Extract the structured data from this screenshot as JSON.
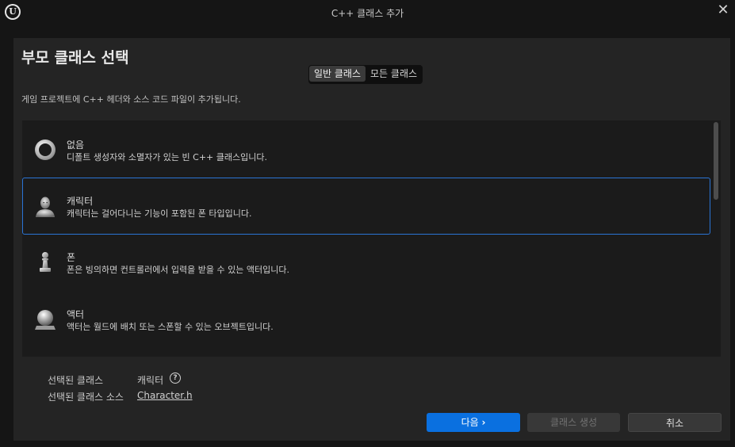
{
  "window": {
    "title": "C++ 클래스 추가",
    "close_icon": "✕"
  },
  "heading": "부모 클래스 선택",
  "tabs": [
    {
      "label": "일반 클래스",
      "active": true
    },
    {
      "label": "모든 클래스",
      "active": false
    }
  ],
  "description": "게임 프로젝트에 C++ 헤더와 소스 코드 파일이 추가됩니다.",
  "classes": [
    {
      "name": "없음",
      "desc": "디폴트 생성자와 소멸자가 있는 빈 C++ 클래스입니다.",
      "icon": "ring-icon",
      "selected": false
    },
    {
      "name": "캐릭터",
      "desc": "캐릭터는 걸어다니는 기능이 포함된 폰 타입입니다.",
      "icon": "character-icon",
      "selected": true
    },
    {
      "name": "폰",
      "desc": "폰은 빙의하면 컨트롤러에서 입력을 받을 수 있는 액터입니다.",
      "icon": "pawn-icon",
      "selected": false
    },
    {
      "name": "액터",
      "desc": "액터는 월드에 배치 또는 스폰할 수 있는 오브젝트입니다.",
      "icon": "actor-sphere-icon",
      "selected": false
    }
  ],
  "selection": {
    "class_label": "선택된 클래스",
    "class_value": "캐릭터",
    "source_label": "선택된 클래스 소스",
    "source_value": "Character.h",
    "help_icon": "?"
  },
  "buttons": {
    "next": "다음",
    "next_icon": "›",
    "create": "클래스 생성",
    "cancel": "취소"
  },
  "colors": {
    "accent": "#0a70e0",
    "selection_border": "#2a74d5",
    "panel": "#242424",
    "list_bg": "#1b1b1b"
  }
}
